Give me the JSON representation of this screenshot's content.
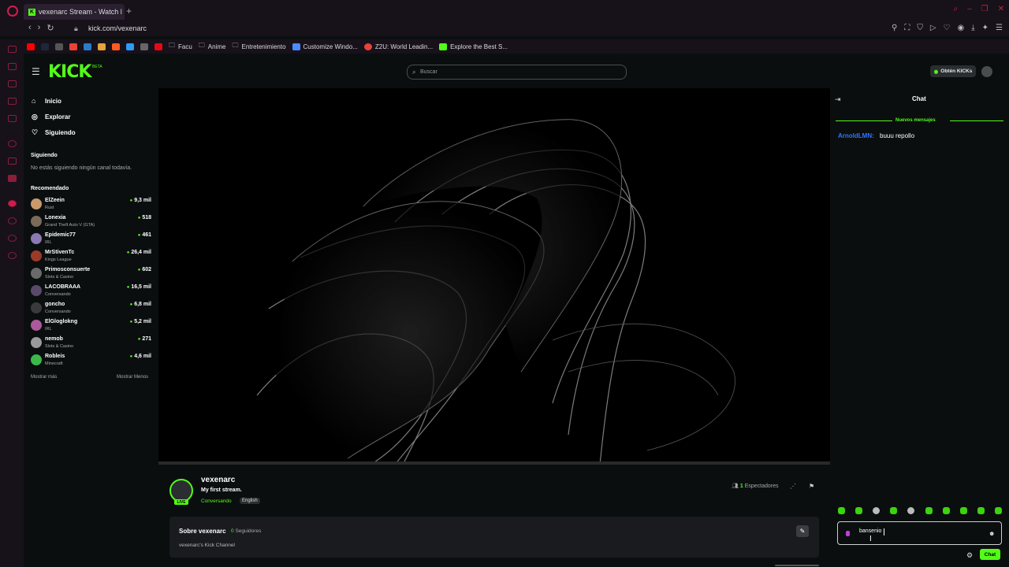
{
  "browser": {
    "tab_title": "vexenarc Stream - Watch l",
    "url": "kick.com/vexenarc",
    "bookmarks": [
      {
        "label": "Facu",
        "color": "#d9d9d9"
      },
      {
        "label": "Anime",
        "color": "#d9d9d9"
      },
      {
        "label": "Entretenimiento",
        "color": "#d9d9d9"
      },
      {
        "label": "Customize Windo...",
        "color": "#4a8cff"
      },
      {
        "label": "Z2U: World Leadin...",
        "color": "#e8423a"
      },
      {
        "label": "Explore the Best S...",
        "color": "#53fc18"
      }
    ]
  },
  "header": {
    "logo": "KICK",
    "beta": "BETA",
    "search_placeholder": "Buscar",
    "kicks_button": "Obtén KICKs"
  },
  "sidebar": {
    "nav": [
      {
        "label": "Inicio",
        "icon": "home-icon"
      },
      {
        "label": "Explorar",
        "icon": "compass-icon"
      },
      {
        "label": "Siguiendo",
        "icon": "heart-icon"
      }
    ],
    "following_title": "Siguiendo",
    "not_following": "No estás siguiendo ningún canal todavía.",
    "recommended_title": "Recomendado",
    "recommended": [
      {
        "name": "ElZeein",
        "category": "Rust",
        "viewers": "9,3 mil"
      },
      {
        "name": "Lonexia",
        "category": "Grand Theft Auto V (GTA)",
        "viewers": "518"
      },
      {
        "name": "Epidemic77",
        "category": "IRL",
        "viewers": "461"
      },
      {
        "name": "MrStivenTc",
        "category": "Kings League",
        "viewers": "26,4 mil"
      },
      {
        "name": "Primosconsuerte",
        "category": "Slots & Casino",
        "viewers": "602"
      },
      {
        "name": "LACOBRAAA",
        "category": "Conversando",
        "viewers": "16,5 mil"
      },
      {
        "name": "goncho",
        "category": "Conversando",
        "viewers": "6,8 mil"
      },
      {
        "name": "ElGloglokng",
        "category": "IRL",
        "viewers": "5,2 mil"
      },
      {
        "name": "nemob",
        "category": "Slots & Casino",
        "viewers": "271"
      },
      {
        "name": "Robleis",
        "category": "Minecraft",
        "viewers": "4,6 mil"
      }
    ],
    "show_more": "Mostrar más",
    "show_less": "Mostrar Menos"
  },
  "stream": {
    "channel": "vexenarc",
    "title": "My first stream.",
    "category": "Conversando",
    "language": "English",
    "live": "LIVE",
    "viewers_count": "1",
    "viewers_label": "Espectadores"
  },
  "about": {
    "title": "Sobre vexenarc",
    "followers_count": "0",
    "followers_label": "Seguidores",
    "description": "vexenarc's Kick Channel"
  },
  "chat": {
    "title": "Chat",
    "new_messages": "Nuevos mensajes",
    "messages": [
      {
        "user": "ArnoldLMN",
        "text": "buuu repollo",
        "user_color": "#2f74ff"
      }
    ],
    "input_value": "bansenio",
    "send_label": "Chat"
  },
  "colors": {
    "accent": "#53fc18",
    "opera": "#d31c4b"
  }
}
